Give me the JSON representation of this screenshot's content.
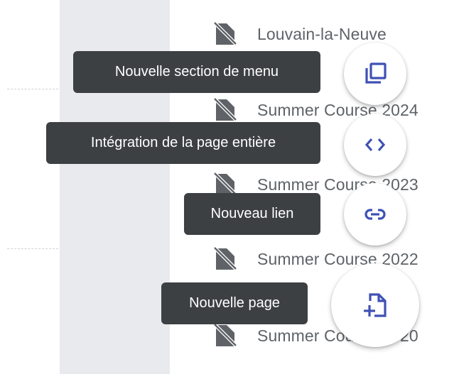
{
  "pages": [
    {
      "label": "Louvain-la-Neuve",
      "icon": "hidden-page-icon"
    },
    {
      "label": "Summer Course 2024",
      "icon": "hidden-page-icon"
    },
    {
      "label": "Summer Course 2023",
      "icon": "hidden-page-icon"
    },
    {
      "label": "Summer Course 2022",
      "icon": "hidden-page-icon"
    },
    {
      "label": "Summer Course 2020",
      "icon": "hidden-page-icon"
    }
  ],
  "actions": {
    "new_menu_section": {
      "tooltip": "Nouvelle section de menu",
      "icon": "menu-section-icon"
    },
    "full_page_embed": {
      "tooltip": "Intégration de la page entière",
      "icon": "code-icon"
    },
    "new_link": {
      "tooltip": "Nouveau lien",
      "icon": "link-icon"
    },
    "new_page": {
      "tooltip": "Nouvelle page",
      "icon": "add-page-icon"
    }
  },
  "colors": {
    "accent": "#3f51b5",
    "tooltip_bg": "#3c4043",
    "page_text": "#5f6368",
    "page_icon": "#5f6368",
    "rail_bg": "#e8eaed"
  }
}
